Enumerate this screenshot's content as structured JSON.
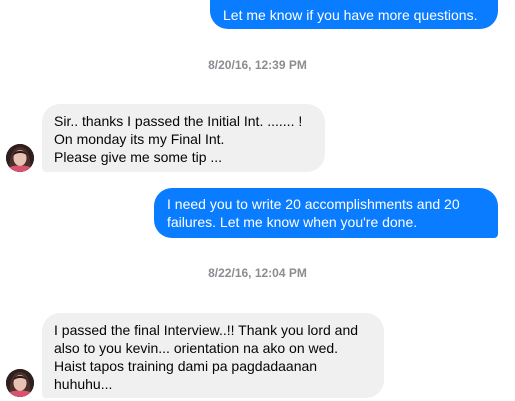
{
  "conversation": {
    "messages": [
      {
        "direction": "outgoing",
        "text": "Let me know if you have more questions."
      },
      {
        "direction": "incoming",
        "text": "Sir.. thanks I passed the Initial Int. ....... !\nOn monday its my Final Int.\nPlease give me some tip ..."
      },
      {
        "direction": "outgoing",
        "text": "I need you to write 20 accomplishments and 20\nfailures. Let me know when you're done."
      },
      {
        "direction": "incoming",
        "text": "I passed the final Interview..!! Thank you lord and\nalso to you kevin... orientation na ako on wed.\nHaist tapos training dami pa pagdadaanan\nhuhuhu..."
      }
    ],
    "timestamps": [
      "8/20/16, 12:39 PM",
      "8/22/16, 12:04 PM"
    ]
  },
  "colors": {
    "outgoing_bubble": "#0a7cff",
    "incoming_bubble": "#f0f0f0",
    "timestamp_text": "#8a8d91"
  },
  "icons": {
    "avatar": "contact-avatar"
  }
}
